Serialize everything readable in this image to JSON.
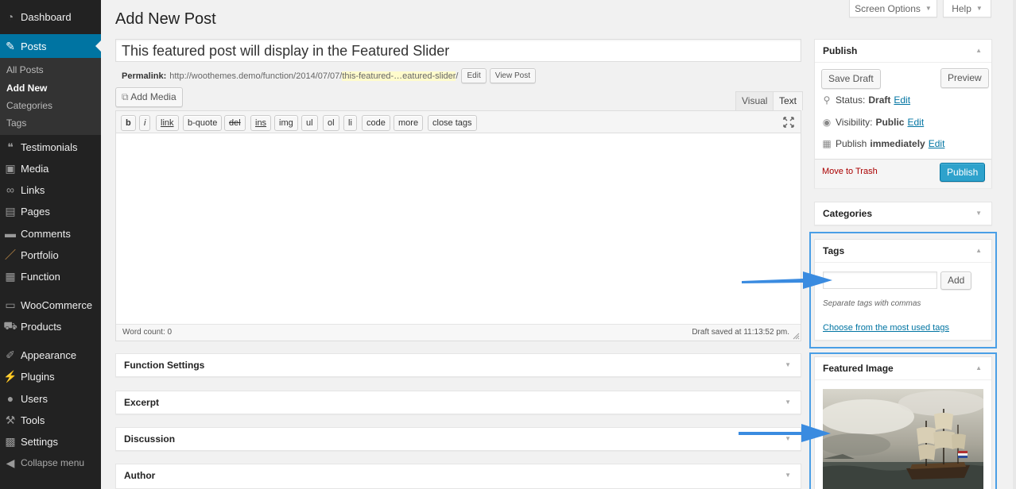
{
  "colors": {
    "sidebar_bg": "#222222",
    "accent": "#0074a2",
    "primary_button": "#2ea2cc",
    "highlight": "#4a9fe6",
    "trash": "#aa0000"
  },
  "sidebar": {
    "items": [
      {
        "icon": "dashboard-icon",
        "label": "Dashboard"
      },
      {
        "icon": "pin-icon",
        "label": "Posts"
      },
      {
        "icon": "quote-icon",
        "label": "Testimonials"
      },
      {
        "icon": "media-icon",
        "label": "Media"
      },
      {
        "icon": "link-icon",
        "label": "Links"
      },
      {
        "icon": "pages-icon",
        "label": "Pages"
      },
      {
        "icon": "comments-icon",
        "label": "Comments"
      },
      {
        "icon": "portfolio-icon",
        "label": "Portfolio"
      },
      {
        "icon": "woo-w-icon",
        "label": "Function"
      },
      {
        "icon": "woocommerce-icon",
        "label": "WooCommerce"
      },
      {
        "icon": "cart-icon",
        "label": "Products"
      },
      {
        "icon": "brush-icon",
        "label": "Appearance"
      },
      {
        "icon": "plugin-icon",
        "label": "Plugins"
      },
      {
        "icon": "user-icon",
        "label": "Users"
      },
      {
        "icon": "wrench-icon",
        "label": "Tools"
      },
      {
        "icon": "settings-icon",
        "label": "Settings"
      },
      {
        "icon": "collapse-icon",
        "label": "Collapse menu"
      }
    ],
    "submenu": [
      "All Posts",
      "Add New",
      "Categories",
      "Tags"
    ]
  },
  "header": {
    "title": "Add New Post",
    "screen_options": "Screen Options",
    "help": "Help"
  },
  "post": {
    "title": "This featured post will display in the Featured Slider",
    "permalink_label": "Permalink:",
    "permalink_base": "http://woothemes.demo/function/2014/07/07/",
    "permalink_slug": "this-featured-…eatured-slider",
    "permalink_trail": "/",
    "edit_button": "Edit",
    "view_post_button": "View Post"
  },
  "editor": {
    "add_media": "Add Media",
    "tab_visual": "Visual",
    "tab_text": "Text",
    "quicktags": [
      "b",
      "i",
      "link",
      "b-quote",
      "del",
      "ins",
      "img",
      "ul",
      "ol",
      "li",
      "code",
      "more",
      "close tags"
    ],
    "word_count": "Word count: 0",
    "draft_saved": "Draft saved at 11:13:52 pm."
  },
  "metaboxes": {
    "function_settings": "Function Settings",
    "excerpt": "Excerpt",
    "discussion": "Discussion",
    "author": "Author"
  },
  "publish": {
    "title": "Publish",
    "save_draft": "Save Draft",
    "preview": "Preview",
    "status_label": "Status:",
    "status_value": "Draft",
    "visibility_label": "Visibility:",
    "visibility_value": "Public",
    "publish_label": "Publish",
    "publish_value": "immediately",
    "edit": "Edit",
    "move_to_trash": "Move to Trash",
    "publish_button": "Publish"
  },
  "categories": {
    "title": "Categories"
  },
  "tags": {
    "title": "Tags",
    "input_value": "",
    "add_button": "Add",
    "hint": "Separate tags with commas",
    "most_used_link": "Choose from the most used tags"
  },
  "featured_image": {
    "title": "Featured Image"
  }
}
